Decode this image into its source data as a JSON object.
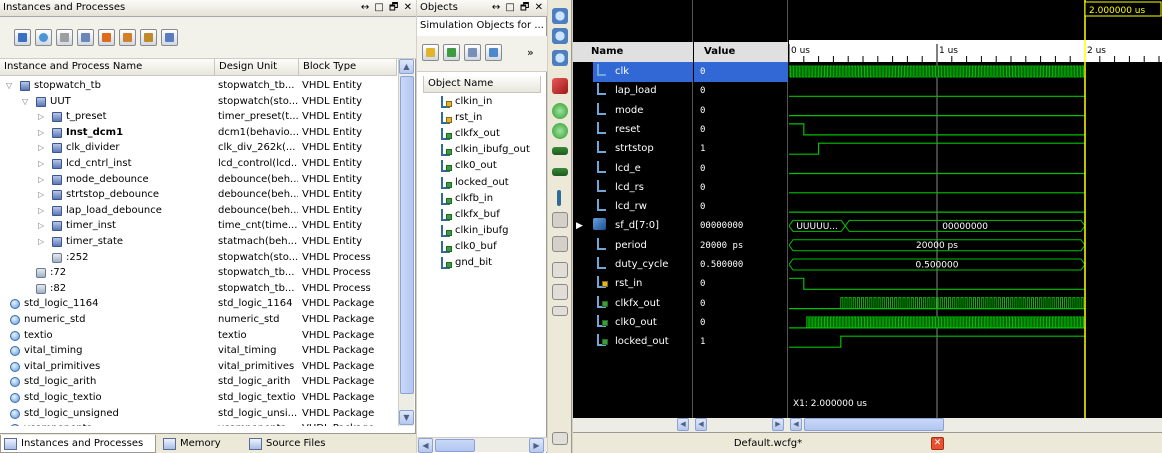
{
  "instances_panel": {
    "title": "Instances and Processes",
    "title_controls": "↔ □ 🗗 ✕",
    "columns": [
      "Instance and Process Name",
      "Design Unit",
      "Block Type"
    ],
    "rows": [
      {
        "name": "stopwatch_tb",
        "unit": "stopwatch_tb...",
        "type": "VHDL Entity",
        "indent": 0,
        "icon": "module-icon",
        "exp": "▽"
      },
      {
        "name": "UUT",
        "unit": "stopwatch(sto...",
        "type": "VHDL Entity",
        "indent": 1,
        "icon": "module-icon",
        "exp": "▽"
      },
      {
        "name": "t_preset",
        "unit": "timer_preset(t...",
        "type": "VHDL Entity",
        "indent": 2,
        "icon": "module-icon",
        "exp": "▷"
      },
      {
        "name": "Inst_dcm1",
        "unit": "dcm1(behavio...",
        "type": "VHDL Entity",
        "indent": 2,
        "icon": "module-icon",
        "exp": "▷",
        "bold": true
      },
      {
        "name": "clk_divider",
        "unit": "clk_div_262k(...",
        "type": "VHDL Entity",
        "indent": 2,
        "icon": "module-icon",
        "exp": "▷"
      },
      {
        "name": "lcd_cntrl_inst",
        "unit": "lcd_control(lcd...",
        "type": "VHDL Entity",
        "indent": 2,
        "icon": "module-icon",
        "exp": "▷"
      },
      {
        "name": "mode_debounce",
        "unit": "debounce(beh...",
        "type": "VHDL Entity",
        "indent": 2,
        "icon": "module-icon",
        "exp": "▷"
      },
      {
        "name": "strtstop_debounce",
        "unit": "debounce(beh...",
        "type": "VHDL Entity",
        "indent": 2,
        "icon": "module-icon",
        "exp": "▷"
      },
      {
        "name": "lap_load_debounce",
        "unit": "debounce(beh...",
        "type": "VHDL Entity",
        "indent": 2,
        "icon": "module-icon",
        "exp": "▷"
      },
      {
        "name": "timer_inst",
        "unit": "time_cnt(time...",
        "type": "VHDL Entity",
        "indent": 2,
        "icon": "module-icon",
        "exp": "▷"
      },
      {
        "name": "timer_state",
        "unit": "statmach(beh...",
        "type": "VHDL Entity",
        "indent": 2,
        "icon": "module-icon",
        "exp": "▷"
      },
      {
        "name": ":252",
        "unit": "stopwatch(sto...",
        "type": "VHDL Process",
        "indent": 2,
        "icon": "process-icon",
        "exp": ""
      },
      {
        "name": ":72",
        "unit": "stopwatch_tb...",
        "type": "VHDL Process",
        "indent": 1,
        "icon": "process-icon",
        "exp": ""
      },
      {
        "name": ":82",
        "unit": "stopwatch_tb...",
        "type": "VHDL Process",
        "indent": 1,
        "icon": "process-icon",
        "exp": ""
      },
      {
        "name": "std_logic_1164",
        "unit": "std_logic_1164",
        "type": "VHDL Package",
        "indent": 0,
        "icon": "package-icon",
        "exp": ""
      },
      {
        "name": "numeric_std",
        "unit": "numeric_std",
        "type": "VHDL Package",
        "indent": 0,
        "icon": "package-icon",
        "exp": ""
      },
      {
        "name": "textio",
        "unit": "textio",
        "type": "VHDL Package",
        "indent": 0,
        "icon": "package-icon",
        "exp": ""
      },
      {
        "name": "vital_timing",
        "unit": "vital_timing",
        "type": "VHDL Package",
        "indent": 0,
        "icon": "package-icon",
        "exp": ""
      },
      {
        "name": "vital_primitives",
        "unit": "vital_primitives",
        "type": "VHDL Package",
        "indent": 0,
        "icon": "package-icon",
        "exp": ""
      },
      {
        "name": "std_logic_arith",
        "unit": "std_logic_arith",
        "type": "VHDL Package",
        "indent": 0,
        "icon": "package-icon",
        "exp": ""
      },
      {
        "name": "std_logic_textio",
        "unit": "std_logic_textio",
        "type": "VHDL Package",
        "indent": 0,
        "icon": "package-icon",
        "exp": ""
      },
      {
        "name": "std_logic_unsigned",
        "unit": "std_logic_unsi...",
        "type": "VHDL Package",
        "indent": 0,
        "icon": "package-icon",
        "exp": ""
      },
      {
        "name": "vcomponents",
        "unit": "vcomponents",
        "type": "VHDL Package",
        "indent": 0,
        "icon": "package-icon",
        "exp": ""
      }
    ],
    "tabs": [
      "Instances and Processes",
      "Memory",
      "Source Files"
    ]
  },
  "objects_panel": {
    "title": "Objects",
    "title_controls": "↔ □ 🗗 ✕",
    "subtitle": "Simulation Objects for ...",
    "more": "»",
    "column": "Object Name",
    "items": [
      {
        "name": "clkin_in",
        "kind": "in"
      },
      {
        "name": "rst_in",
        "kind": "in"
      },
      {
        "name": "clkfx_out",
        "kind": "out"
      },
      {
        "name": "clkin_ibufg_out",
        "kind": "out"
      },
      {
        "name": "clk0_out",
        "kind": "out"
      },
      {
        "name": "locked_out",
        "kind": "out"
      },
      {
        "name": "clkfb_in",
        "kind": "out"
      },
      {
        "name": "clkfx_buf",
        "kind": "out"
      },
      {
        "name": "clkin_ibufg",
        "kind": "out"
      },
      {
        "name": "clk0_buf",
        "kind": "out"
      },
      {
        "name": "gnd_bit",
        "kind": "out"
      }
    ]
  },
  "wave": {
    "name_header": "Name",
    "value_header": "Value",
    "cursor_label": "2.000000 us",
    "ruler": [
      "0 us",
      "1 us",
      "2 us"
    ],
    "x1_label": "X1: 2.000000 us",
    "footer_file": "Default.wcfg*",
    "signals": [
      {
        "name": "clk",
        "value": "0",
        "kind": "sig",
        "selected": true
      },
      {
        "name": "lap_load",
        "value": "0",
        "kind": "sig"
      },
      {
        "name": "mode",
        "value": "0",
        "kind": "sig"
      },
      {
        "name": "reset",
        "value": "0",
        "kind": "sig"
      },
      {
        "name": "strtstop",
        "value": "1",
        "kind": "sig"
      },
      {
        "name": "lcd_e",
        "value": "0",
        "kind": "sig"
      },
      {
        "name": "lcd_rs",
        "value": "0",
        "kind": "sig"
      },
      {
        "name": "lcd_rw",
        "value": "0",
        "kind": "sig"
      },
      {
        "name": "sf_d[7:0]",
        "value": "00000000",
        "kind": "bus"
      },
      {
        "name": "period",
        "value": "20000 ps",
        "kind": "const"
      },
      {
        "name": "duty_cycle",
        "value": "0.500000",
        "kind": "const"
      },
      {
        "name": "rst_in",
        "value": "0",
        "kind": "in"
      },
      {
        "name": "clkfx_out",
        "value": "0",
        "kind": "out"
      },
      {
        "name": "clk0_out",
        "value": "0",
        "kind": "out"
      },
      {
        "name": "locked_out",
        "value": "1",
        "kind": "out"
      }
    ],
    "bus_labels": {
      "sf_d_first": "UUUUU...",
      "sf_d_second": "00000000",
      "period": "20000 ps",
      "duty_cycle": "0.500000"
    }
  },
  "colors": {
    "wave_green": "#00c000",
    "cursor_yellow": "#ffff00",
    "selection_blue": "#3168d5"
  }
}
